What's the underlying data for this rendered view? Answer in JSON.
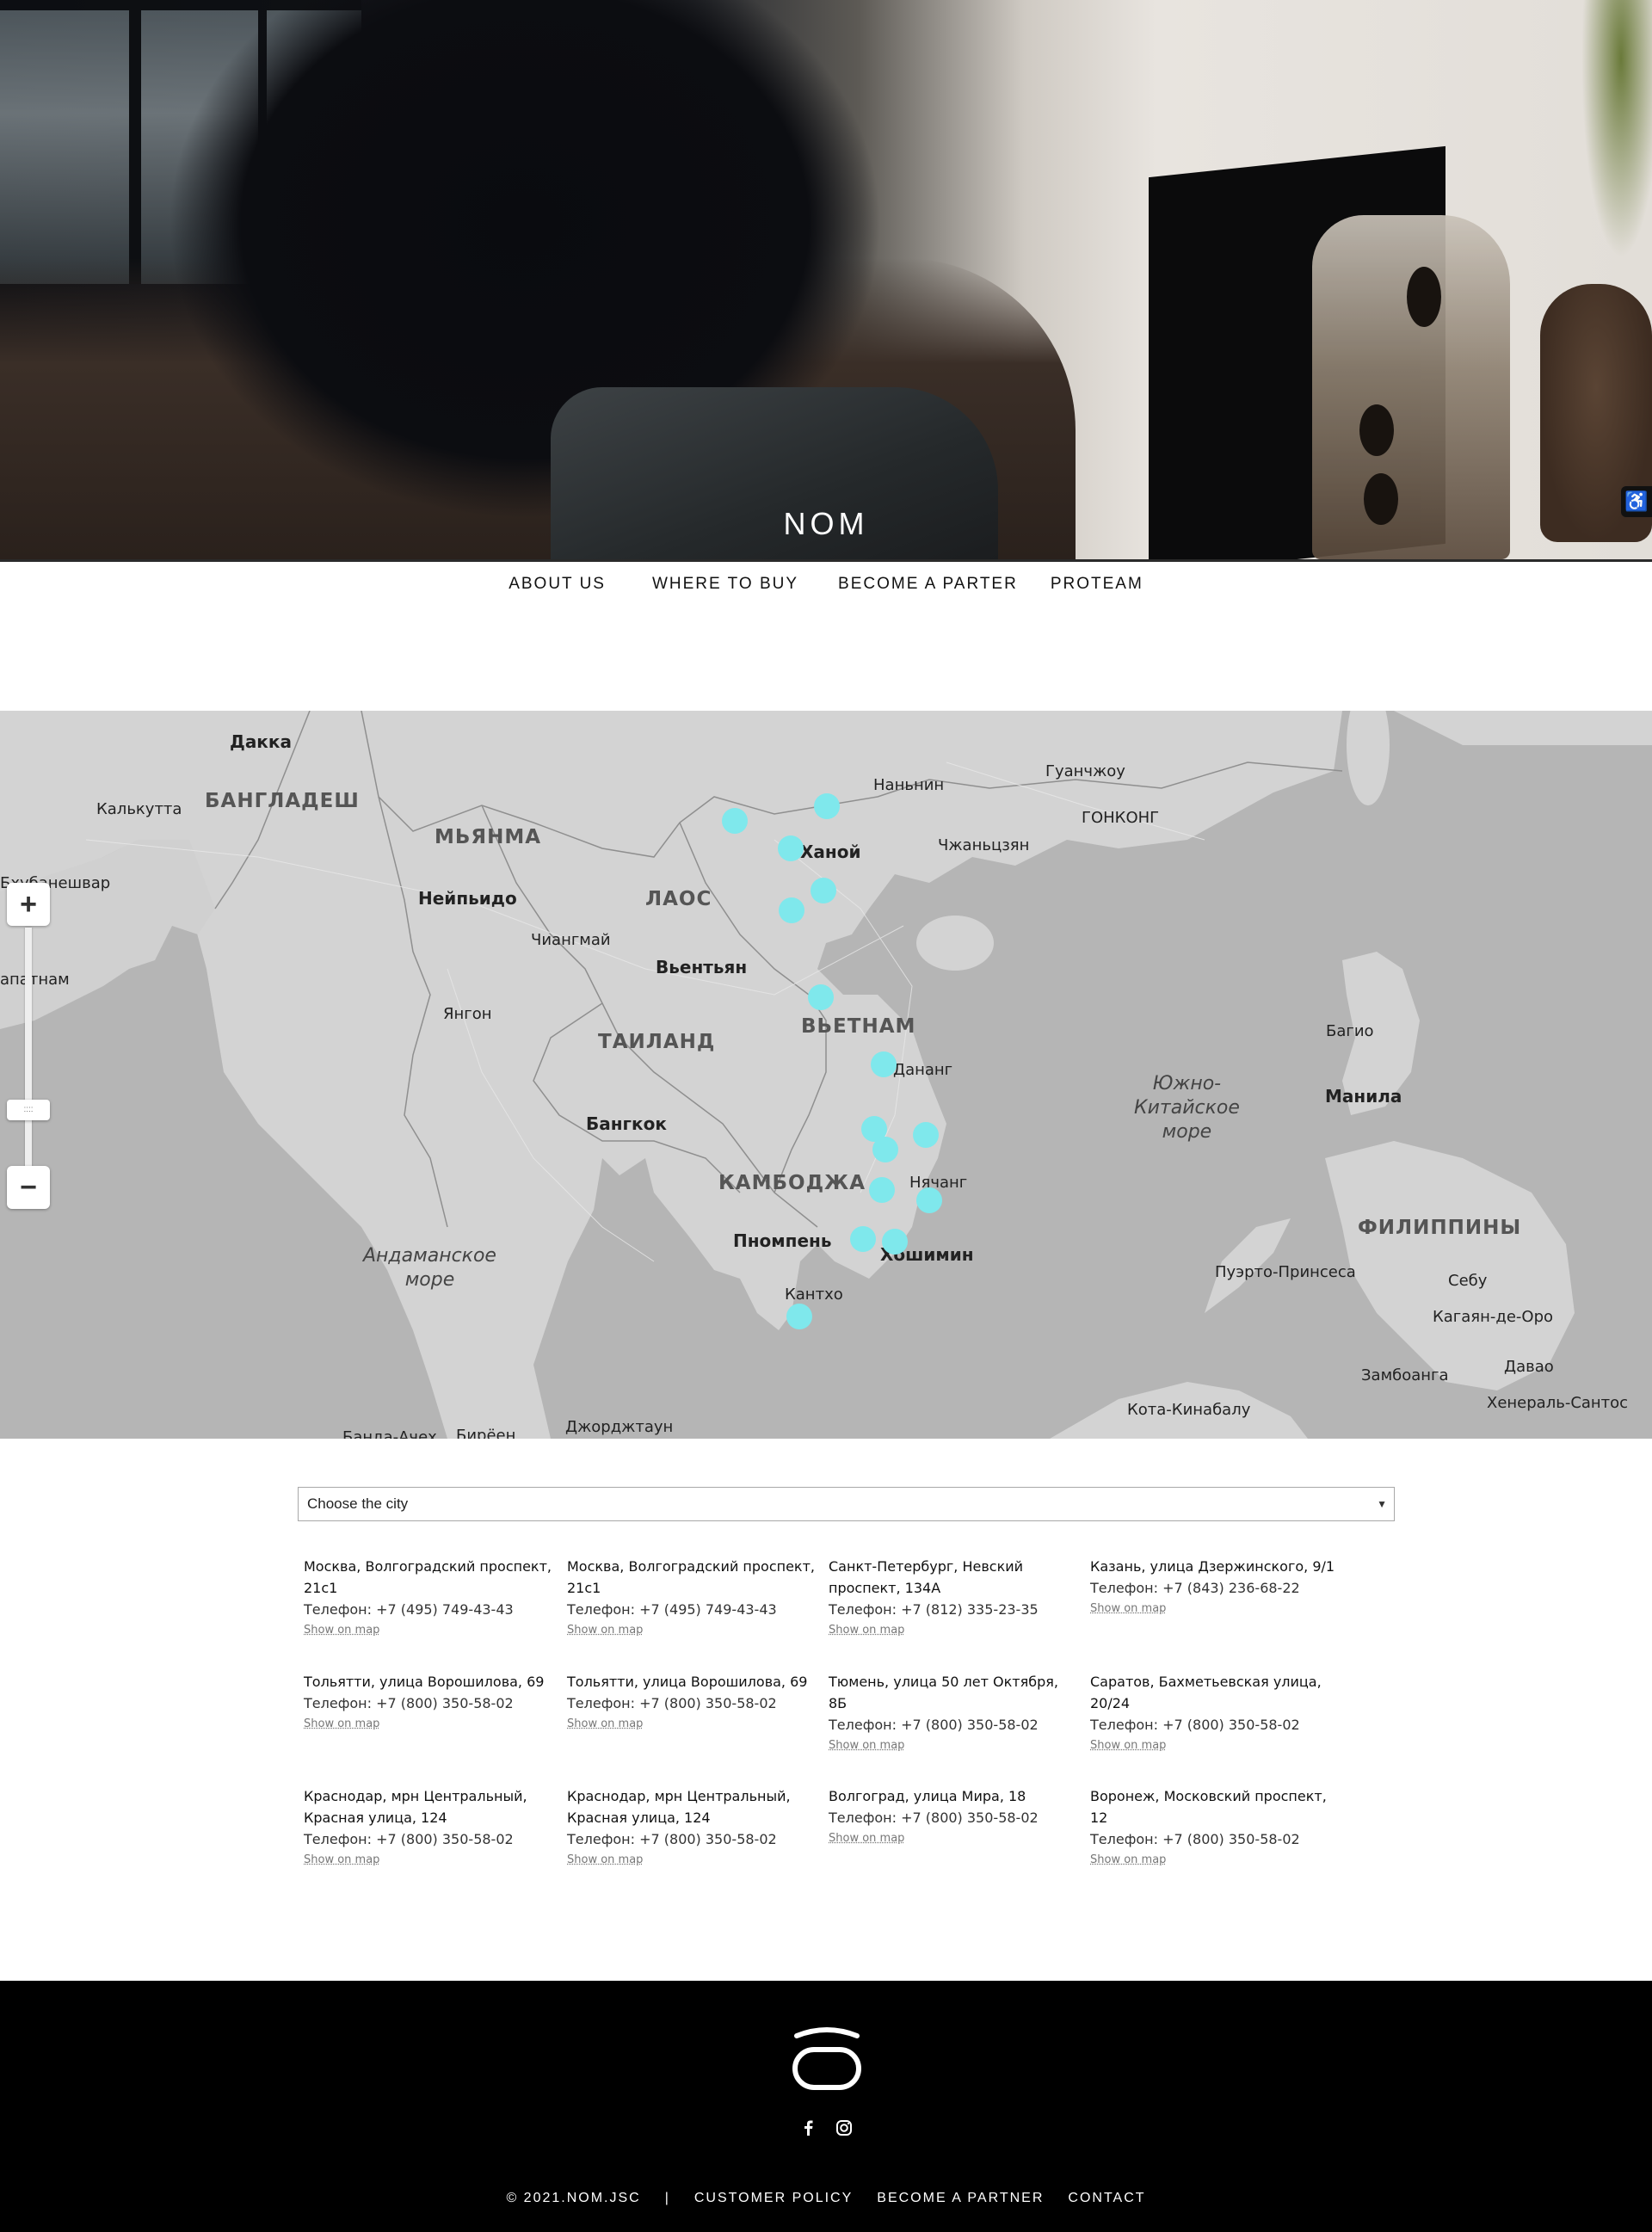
{
  "hero": {
    "brand": "NOM",
    "accessibility_icon": "wheelchair-icon"
  },
  "nav": {
    "items": [
      "ABOUT US",
      "WHERE TO BUY",
      "BECOME A PARTER",
      "PROTEAM"
    ]
  },
  "map": {
    "countries": [
      "МЬЯНМА",
      "ЛАОС",
      "ТАИЛАНД",
      "ВЬЕТНАМ",
      "КАМБОДЖА",
      "ФИЛИППИНЫ",
      "БАНГЛАДЕШ"
    ],
    "capitals": [
      "Дакка",
      "Нейпьидо",
      "Вьентьян",
      "Бангкок",
      "Пномпень",
      "Манила",
      "Ханой"
    ],
    "cities": [
      "Калькутта",
      "Бхубанешвар",
      "апатнам",
      "Янгон",
      "Чиангмай",
      "Наньнин",
      "Гуанчжоу",
      "ГОНКОНГ",
      "Чжаньцзян",
      "Дананг",
      "Нячанг",
      "Хошимин",
      "Кантхо",
      "Багио",
      "Пуэрто-Принсеса",
      "Себу",
      "Кагаян-де-Оро",
      "Замбоанга",
      "Давао",
      "Хенераль-Сантос",
      "Кота-Кинабалу",
      "Джорджтаун",
      "Банда-Ачех",
      "Бирёен"
    ],
    "seas": [
      "Андаманское\nморе",
      "Южно-\nКитайское\nморе"
    ],
    "pin_color": "#7fe8ec",
    "zoom_in_icon": "plus-icon",
    "zoom_out_icon": "minus-icon"
  },
  "city_select": {
    "placeholder": "Choose the city"
  },
  "stores": [
    {
      "addr": "Москва, Волгоградский проспект, 21с1",
      "phone": "Телефон: +7 (495) 749-43-43",
      "show": "Show on map"
    },
    {
      "addr": "Москва, Волгоградский проспект, 21с1",
      "phone": "Телефон: +7 (495) 749-43-43",
      "show": "Show on map"
    },
    {
      "addr": "Санкт-Петербург, Невский проспект, 134А",
      "phone": "Телефон: +7 (812) 335-23-35",
      "show": "Show on map"
    },
    {
      "addr": "Казань, улица Дзержинского, 9/1",
      "phone": "Телефон: +7 (843) 236-68-22",
      "show": "Show on map"
    },
    {
      "addr": "Тольятти, улица Ворошилова, 69",
      "phone": "Телефон: +7 (800) 350-58-02",
      "show": "Show on map"
    },
    {
      "addr": "Тольятти, улица Ворошилова, 69",
      "phone": "Телефон: +7 (800) 350-58-02",
      "show": "Show on map"
    },
    {
      "addr": "Тюмень, улица 50 лет Октября, 8Б",
      "phone": "Телефон: +7 (800) 350-58-02",
      "show": "Show on map"
    },
    {
      "addr": "Саратов, Бахметьевская улица, 20/24",
      "phone": "Телефон: +7 (800) 350-58-02",
      "show": "Show on map"
    },
    {
      "addr": "Краснодар, мрн Центральный, Красная улица, 124",
      "phone": "Телефон: +7 (800) 350-58-02",
      "show": "Show on map"
    },
    {
      "addr": "Краснодар, мрн Центральный, Красная улица, 124",
      "phone": "Телефон: +7 (800) 350-58-02",
      "show": "Show on map"
    },
    {
      "addr": "Волгоград, улица Мира, 18",
      "phone": "Телефон: +7 (800) 350-58-02",
      "show": "Show on map"
    },
    {
      "addr": "Воронеж, Московский проспект, 12",
      "phone": "Телефон: +7 (800) 350-58-02",
      "show": "Show on map"
    }
  ],
  "footer": {
    "logo_icon": "nom-logo-icon",
    "social_icons": [
      "facebook-icon",
      "instagram-icon"
    ],
    "copyright": "© 2021.NOM.JSC",
    "separator": "|",
    "links": [
      "CUSTOMER POLICY",
      "BECOME A PARTNER",
      "CONTACT"
    ]
  }
}
